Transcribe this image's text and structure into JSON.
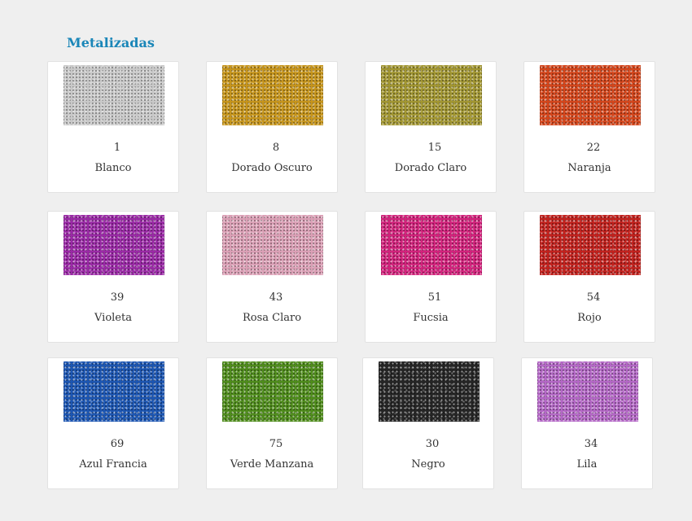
{
  "section": {
    "title": "Metalizadas"
  },
  "items": [
    {
      "code": "1",
      "name": "Blanco",
      "color": "#c9c9c9"
    },
    {
      "code": "8",
      "name": "Dorado Oscuro",
      "color": "#c6951c"
    },
    {
      "code": "15",
      "name": "Dorado Claro",
      "color": "#a29632"
    },
    {
      "code": "22",
      "name": "Naranja",
      "color": "#d4461c"
    },
    {
      "code": "39",
      "name": "Violeta",
      "color": "#9a2aa6"
    },
    {
      "code": "43",
      "name": "Rosa Claro",
      "color": "#dba0b6"
    },
    {
      "code": "51",
      "name": "Fucsia",
      "color": "#d2237c"
    },
    {
      "code": "54",
      "name": "Rojo",
      "color": "#c2221e"
    },
    {
      "code": "69",
      "name": "Azul Francia",
      "color": "#1d56b2"
    },
    {
      "code": "75",
      "name": "Verde Manzana",
      "color": "#4f8c1c"
    },
    {
      "code": "30",
      "name": "Negro",
      "color": "#262626"
    },
    {
      "code": "34",
      "name": "Lila",
      "color": "#b468c6"
    }
  ]
}
